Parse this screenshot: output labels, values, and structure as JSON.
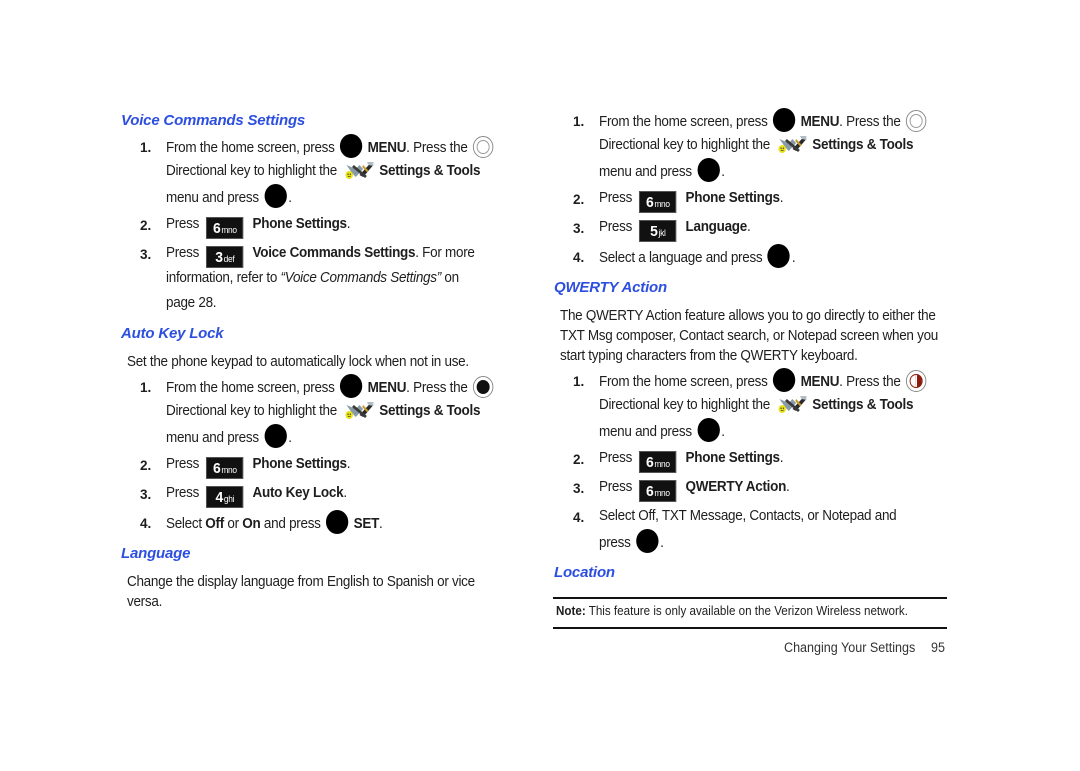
{
  "left": {
    "voice": {
      "heading": "Voice Commands Settings",
      "s1": {
        "num": "1.",
        "a": "From the home screen, press",
        "menu": "MENU",
        "b": ". Press the",
        "c": "Directional key to highlight the",
        "tools": "Settings & Tools",
        "d": "menu and press",
        "e": "."
      },
      "s2": {
        "num": "2.",
        "press": "Press",
        "key_digit": "6",
        "key_letters": "mno",
        "label": "Phone Settings",
        "end": "."
      },
      "s3": {
        "num": "3.",
        "press": "Press",
        "key_digit": "3",
        "key_letters": "def",
        "label": "Voice Commands Settings",
        "rest": ". For more",
        "line2a": "information, refer to ",
        "ref": "“Voice Commands Settings”",
        "line2b": " on",
        "line3": "page 28."
      }
    },
    "autokey": {
      "heading": "Auto Key Lock",
      "intro": "Set the phone keypad to automatically lock when not in use.",
      "s1": {
        "num": "1.",
        "a": "From the home screen, press",
        "menu": "MENU",
        "b": ". Press the",
        "c": "Directional key to highlight the",
        "tools": "Settings & Tools",
        "d": "menu and press",
        "e": "."
      },
      "s2": {
        "num": "2.",
        "press": "Press",
        "key_digit": "6",
        "key_letters": "mno",
        "label": "Phone Settings",
        "end": "."
      },
      "s3": {
        "num": "3.",
        "press": "Press",
        "key_digit": "4",
        "key_letters": "ghi",
        "label": "Auto Key Lock",
        "end": "."
      },
      "s4": {
        "num": "4.",
        "a": "Select ",
        "off": "Off",
        "or": " or ",
        "on": "On",
        "b": " and press",
        "set": "SET",
        "end": "."
      }
    },
    "language": {
      "heading": "Language",
      "intro": "Change the display language from English to Spanish or vice versa."
    }
  },
  "right": {
    "language_steps": {
      "s1": {
        "num": "1.",
        "a": "From the home screen, press",
        "menu": "MENU",
        "b": ". Press the",
        "c": "Directional key to highlight the",
        "tools": "Settings & Tools",
        "d": "menu and press",
        "e": "."
      },
      "s2": {
        "num": "2.",
        "press": "Press",
        "key_digit": "6",
        "key_letters": "mno",
        "label": "Phone Settings",
        "end": "."
      },
      "s3": {
        "num": "3.",
        "press": "Press",
        "key_digit": "5",
        "key_letters": "jkl",
        "label": "Language",
        "end": "."
      },
      "s4": {
        "num": "4.",
        "a": "Select a language and press",
        "end": "."
      }
    },
    "qwerty": {
      "heading": "QWERTY Action",
      "intro": "The QWERTY Action feature allows you to go directly to either the TXT Msg composer, Contact search, or Notepad screen when you start typing characters from the QWERTY keyboard.",
      "s1": {
        "num": "1.",
        "a": "From the home screen, press",
        "menu": "MENU",
        "b": ". Press the",
        "c": "Directional key to highlight the",
        "tools": "Settings & Tools",
        "d": "menu and press",
        "e": "."
      },
      "s2": {
        "num": "2.",
        "press": "Press",
        "key_digit": "6",
        "key_letters": "mno",
        "label": "Phone Settings",
        "end": "."
      },
      "s3": {
        "num": "3.",
        "press": "Press",
        "key_digit": "6",
        "key_letters": "mno",
        "label": "QWERTY Action",
        "end": "."
      },
      "s4": {
        "num": "4.",
        "a": "Select Off, TXT Message, Contacts, or Notepad and",
        "b": "press",
        "end": "."
      }
    },
    "location": {
      "heading": "Location"
    },
    "note": {
      "label": "Note:",
      "text": " This feature is only available on the Verizon Wireless network."
    }
  },
  "footer": {
    "section": "Changing Your Settings",
    "page": "95"
  },
  "colors": {
    "heading": "#2d4fe0",
    "text": "#1e1e1e",
    "key_bg": "#111111"
  }
}
